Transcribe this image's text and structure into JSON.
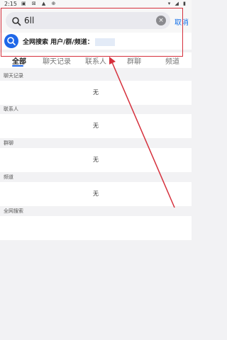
{
  "status_bar": {
    "time": "2:15",
    "left_icons": "▣ ⊠ ▲ ⊕",
    "right_icons": "▾ ◢ ▮"
  },
  "search": {
    "value": "6ll",
    "cancel_label": "取消"
  },
  "global_search": {
    "label": "全网搜索 用户/群/频道："
  },
  "tabs": [
    "全部",
    "聊天记录",
    "联系人",
    "群聊",
    "频道"
  ],
  "sections": [
    {
      "header": "聊天记录",
      "empty_text": "无"
    },
    {
      "header": "联系人",
      "empty_text": "无"
    },
    {
      "header": "群聊",
      "empty_text": "无"
    },
    {
      "header": "频道",
      "empty_text": "无"
    },
    {
      "header": "全网搜索",
      "empty_text": ""
    }
  ],
  "colors": {
    "accent": "#1f67e8",
    "annotation": "#d6303c"
  }
}
